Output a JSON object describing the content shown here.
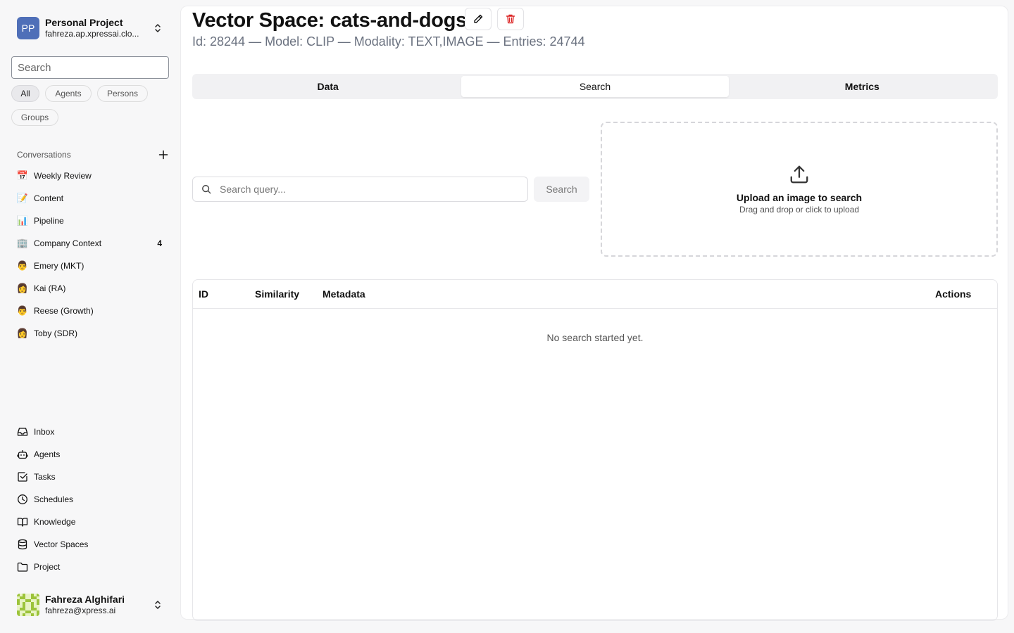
{
  "sidebar": {
    "project": {
      "avatar": "PP",
      "title": "Personal Project",
      "subtitle": "fahreza.ap.xpressai.clo..."
    },
    "search_placeholder": "Search",
    "filters": [
      "All",
      "Agents",
      "Persons",
      "Groups"
    ],
    "active_filter": "All",
    "conversations_title": "Conversations",
    "conversations": [
      {
        "icon": "📅",
        "icon_name": "calendar-icon",
        "label": "Weekly Review",
        "badge": ""
      },
      {
        "icon": "📝",
        "icon_name": "memo-icon",
        "label": "Content",
        "badge": ""
      },
      {
        "icon": "📊",
        "icon_name": "bar-chart-icon",
        "label": "Pipeline",
        "badge": ""
      },
      {
        "icon": "🏢",
        "icon_name": "office-building-icon",
        "label": "Company Context",
        "badge": "4"
      },
      {
        "icon": "👨",
        "icon_name": "person-avatar-icon",
        "label": "Emery (MKT)",
        "badge": ""
      },
      {
        "icon": "👩",
        "icon_name": "person-avatar-icon",
        "label": "Kai (RA)",
        "badge": ""
      },
      {
        "icon": "👨",
        "icon_name": "person-avatar-icon",
        "label": "Reese (Growth)",
        "badge": ""
      },
      {
        "icon": "👩",
        "icon_name": "person-avatar-icon",
        "label": "Toby (SDR)",
        "badge": ""
      }
    ],
    "nav": [
      {
        "icon": "inbox-icon",
        "label": "Inbox"
      },
      {
        "icon": "bot-icon",
        "label": "Agents"
      },
      {
        "icon": "checkbox-icon",
        "label": "Tasks"
      },
      {
        "icon": "clock-icon",
        "label": "Schedules"
      },
      {
        "icon": "book-icon",
        "label": "Knowledge"
      },
      {
        "icon": "database-icon",
        "label": "Vector Spaces"
      },
      {
        "icon": "folder-icon",
        "label": "Project"
      }
    ],
    "user": {
      "name": "Fahreza Alghifari",
      "email": "fahreza@xpress.ai"
    }
  },
  "main": {
    "title": "Vector Space: cats-and-dogs",
    "subtitle": "Id: 28244 — Model: CLIP — Modality: TEXT,IMAGE — Entries: 24744",
    "tabs": [
      "Data",
      "Search",
      "Metrics"
    ],
    "active_tab": "Search",
    "search": {
      "placeholder": "Search query...",
      "value": "",
      "button_label": "Search"
    },
    "upload": {
      "title": "Upload an image to search",
      "subtitle": "Drag and drop or click to upload"
    },
    "results": {
      "columns": [
        "ID",
        "Similarity",
        "Metadata",
        "Actions"
      ],
      "empty_message": "No search started yet."
    }
  },
  "colors": {
    "accent_avatar": "#4f6fb8",
    "delete_red": "#dc2626",
    "muted_text": "#6b7280"
  }
}
